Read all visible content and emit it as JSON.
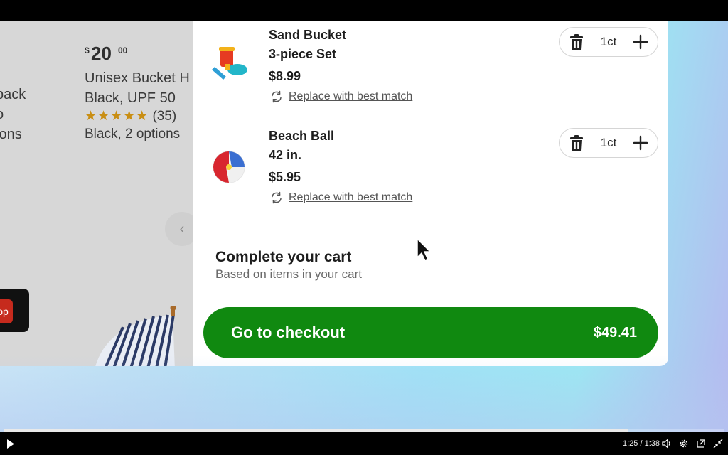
{
  "background_page": {
    "product": {
      "price_symbol": "$",
      "price_dollars": "20",
      "price_cents": "00",
      "title_line1": "Unisex Bucket H",
      "title_line2": "Black, UPF 50",
      "stars": "★★★★★",
      "review_count": "(35)",
      "options": "Black, 2 options"
    },
    "left_fragments": [
      "back",
      "o",
      "ions"
    ],
    "carousel_prev_glyph": "‹",
    "red_button_text": "op"
  },
  "cart": {
    "items": [
      {
        "name_line1": "Sand Bucket",
        "name_line2": "3-piece Set",
        "price": "$8.99",
        "replace_label": "Replace with best match",
        "quantity": "1ct"
      },
      {
        "name_line1": "Beach Ball",
        "name_line2": "42 in.",
        "price": "$5.95",
        "replace_label": "Replace with best match",
        "quantity": "1ct"
      }
    ],
    "complete_section": {
      "title": "Complete your cart",
      "subtitle": "Based on items in your cart"
    },
    "checkout": {
      "label": "Go to checkout",
      "total": "$49.41"
    }
  },
  "video_player": {
    "time": "1:25 / 1:38",
    "progress": 0.867
  },
  "colors": {
    "checkout_green": "#108910",
    "star_gold": "#c98e12",
    "red_button": "#c62a1d"
  }
}
